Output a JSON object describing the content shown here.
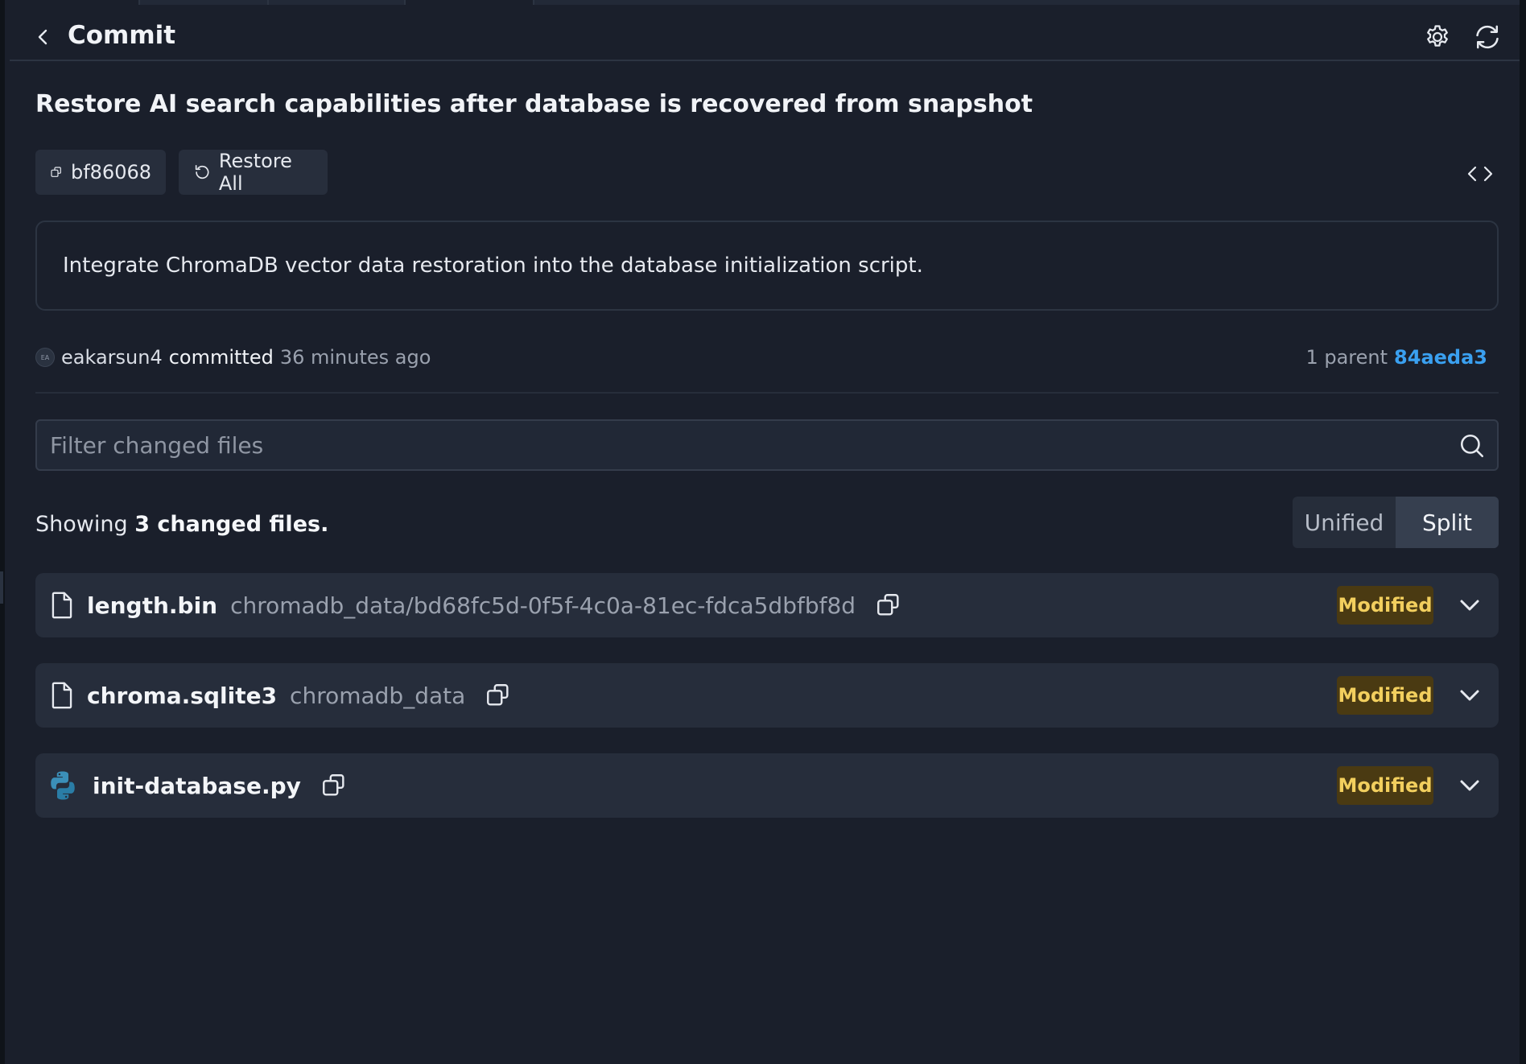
{
  "header": {
    "title": "Commit",
    "back_icon": "chevron-left-icon",
    "settings_icon": "gear-icon",
    "refresh_icon": "refresh-icon"
  },
  "commit": {
    "title": "Restore AI search capabilities after database is recovered from snapshot",
    "hash": "bf86068",
    "restore_label": "Restore All",
    "message": "Integrate ChromaDB vector data restoration into the database initialization script.",
    "author_initials": "EA",
    "author": "eakarsun4",
    "committed_label": "committed",
    "time_ago": "36 minutes ago",
    "parent_label": "1 parent",
    "parent_hash": "84aeda3"
  },
  "filter": {
    "placeholder": "Filter changed files"
  },
  "summary": {
    "prefix": "Showing",
    "count_text": "3 changed files."
  },
  "view_toggle": {
    "unified_label": "Unified",
    "split_label": "Split",
    "selected": "Split"
  },
  "files": [
    {
      "name": "length.bin",
      "path": "chromadb_data/bd68fc5d-0f5f-4c0a-81ec-fdca5dbfbf8d",
      "status": "Modified",
      "icon": "file-icon"
    },
    {
      "name": "chroma.sqlite3",
      "path": "chromadb_data",
      "status": "Modified",
      "icon": "file-icon"
    },
    {
      "name": "init-database.py",
      "path": "",
      "status": "Modified",
      "icon": "python-icon"
    }
  ],
  "colors": {
    "background": "#1a1f2b",
    "accent_link": "#3aa0f0",
    "badge_bg": "#4a3a12",
    "badge_text": "#f2cf5e"
  }
}
